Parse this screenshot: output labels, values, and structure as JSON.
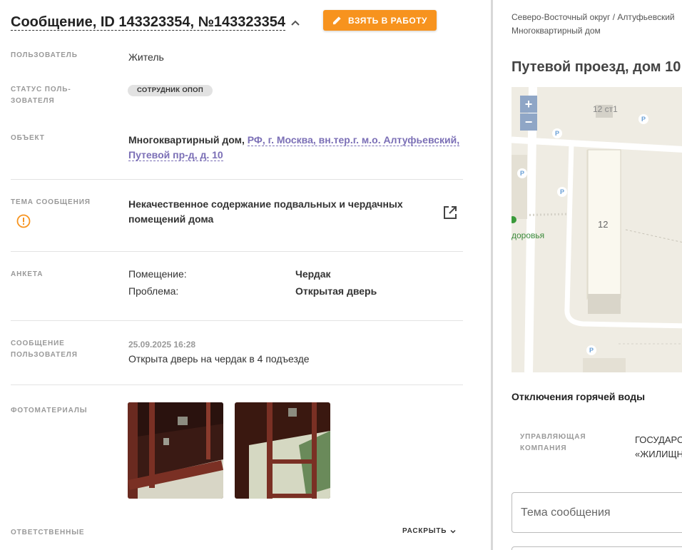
{
  "header": {
    "title": "Сообщение, ID 143323354, №143323354",
    "take_button_label": "ВЗЯТЬ В РАБОТУ"
  },
  "fields": {
    "user_label": "ПОЛЬЗОВАТЕЛЬ",
    "user_value": "Житель",
    "status_label_line1": "СТАТУС ПОЛЬ-",
    "status_label_line2": "ЗОВАТЕЛЯ",
    "status_badge": "СОТРУДНИК ОПОП",
    "object_label": "ОБЪЕКТ",
    "object_type": "Многоквартирный дом,",
    "object_address_line1": "РФ, г. Москва, вн.тер.г. м.о. Алтуфьевский,",
    "object_address_line2": "Путевой пр-д, д. 10",
    "topic_label": "ТЕМА СООБЩЕНИЯ",
    "topic_line1": "Некачественное содержание подвальных и чердачных",
    "topic_line2": "помещений дома",
    "survey_label": "АНКЕТА",
    "survey": [
      {
        "question": "Помещение:",
        "answer": "Чердак"
      },
      {
        "question": "Проблема:",
        "answer": "Открытая дверь"
      }
    ],
    "message_label_line1": "СООБЩЕНИЕ",
    "message_label_line2": "ПОЛЬЗОВАТЕЛЯ",
    "message_date": "25.09.2025 16:28",
    "message_text": "Открыта дверь на чердак в 4 подъезде",
    "photos_label": "ФОТОМАТЕРИАЛЫ",
    "responsible_label": "ОТВЕТСТВЕННЫЕ",
    "expand_label": "РАСКРЫТЬ"
  },
  "right": {
    "breadcrumb_line1": "Северо-Восточный округ / Алтуфьевский",
    "breadcrumb_line2": "Многоквартирный дом",
    "address_title": "Путевой проезд, дом 10",
    "map": {
      "zoom_in": "+",
      "zoom_out": "−",
      "building_label_1": "12 ст1",
      "building_label_2": "12",
      "poi_label": "доровья",
      "parking": "P"
    },
    "hot_water_title": "Отключения горячей воды",
    "mgmt_label_line1": "УПРАВЛЯЮЩАЯ",
    "mgmt_label_line2": "КОМПАНИЯ",
    "mgmt_value_line1": "ГОСУДАРСТВЕННОЕ",
    "mgmt_value_line2": "«ЖИЛИЩНИК»",
    "topic_input_placeholder": "Тема сообщения"
  },
  "colors": {
    "accent_orange": "#f7931e",
    "link_purple": "#7b6fb6",
    "warning_orange": "#f7931e"
  }
}
